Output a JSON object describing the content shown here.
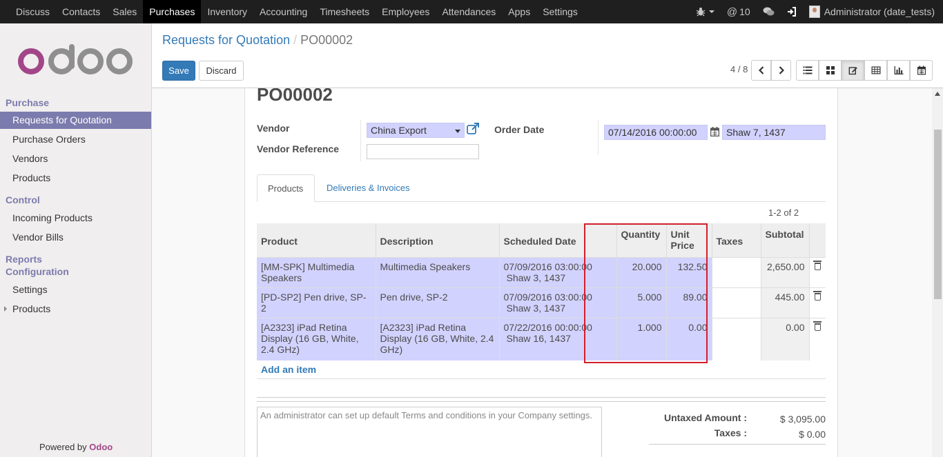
{
  "topbar": {
    "menu": [
      "Discuss",
      "Contacts",
      "Sales",
      "Purchases",
      "Inventory",
      "Accounting",
      "Timesheets",
      "Employees",
      "Attendances",
      "Apps",
      "Settings"
    ],
    "active_menu": "Purchases",
    "messages_count": "10",
    "user": "Administrator (date_tests)"
  },
  "sidebar": {
    "logo_text": "odoo",
    "sections": [
      {
        "title": "Purchase",
        "items": [
          "Requests for Quotation",
          "Purchase Orders",
          "Vendors",
          "Products"
        ]
      },
      {
        "title": "Control",
        "items": [
          "Incoming Products",
          "Vendor Bills"
        ]
      },
      {
        "title": "Reports",
        "items": []
      },
      {
        "title": "Configuration",
        "items": [
          "Settings",
          "Products"
        ]
      }
    ],
    "active_item": "Requests for Quotation",
    "powered_by": "Powered by",
    "powered_brand": "Odoo"
  },
  "control_panel": {
    "breadcrumb_parent": "Requests for Quotation",
    "breadcrumb_sep": "/",
    "breadcrumb_current": "PO00002",
    "save_label": "Save",
    "discard_label": "Discard",
    "pager": "4 / 8"
  },
  "form": {
    "title": "PO00002",
    "vendor_label": "Vendor",
    "vendor_value": "China Export",
    "vendor_ref_label": "Vendor Reference",
    "vendor_ref_value": "",
    "order_date_label": "Order Date",
    "order_date_value": "07/14/2016 00:00:00",
    "order_date_alt": "Shaw 7, 1437"
  },
  "tabs": [
    "Products",
    "Deliveries & Invoices"
  ],
  "record_count": "1-2 of 2",
  "table": {
    "headers": [
      "Product",
      "Description",
      "Scheduled Date",
      "Quantity",
      "Unit Price",
      "Taxes",
      "Subtotal"
    ],
    "rows": [
      {
        "product": "[MM-SPK] Multimedia Speakers",
        "description": "Multimedia Speakers",
        "date": "07/09/2016 03:00:00",
        "date_alt": "Shaw 3, 1437",
        "qty": "20.000",
        "price": "132.50",
        "taxes": "",
        "subtotal": "2,650.00"
      },
      {
        "product": "[PD-SP2] Pen drive, SP-2",
        "description": "Pen drive, SP-2",
        "date": "07/09/2016 03:00:00",
        "date_alt": "Shaw 3, 1437",
        "qty": "5.000",
        "price": "89.00",
        "taxes": "",
        "subtotal": "445.00"
      },
      {
        "product": "[A2323] iPad Retina Display (16 GB, White, 2.4 GHz)",
        "description": "[A2323] iPad Retina Display (16 GB, White, 2.4 GHz)",
        "date": "07/22/2016 00:00:00",
        "date_alt": "Shaw 16, 1437",
        "qty": "1.000",
        "price": "0.00",
        "taxes": "",
        "subtotal": "0.00"
      }
    ]
  },
  "add_item": "Add an item",
  "notes_placeholder": "An administrator can set up default Terms and conditions in your Company settings.",
  "totals": {
    "untaxed_label": "Untaxed Amount :",
    "untaxed_value": "$ 3,095.00",
    "taxes_label": "Taxes :",
    "taxes_value": "$ 0.00"
  },
  "colors": {
    "brand": "#7c7bad",
    "primary": "#337ab7",
    "required_field": "#d2d2ff",
    "highlight_box": "#d21f2b"
  }
}
